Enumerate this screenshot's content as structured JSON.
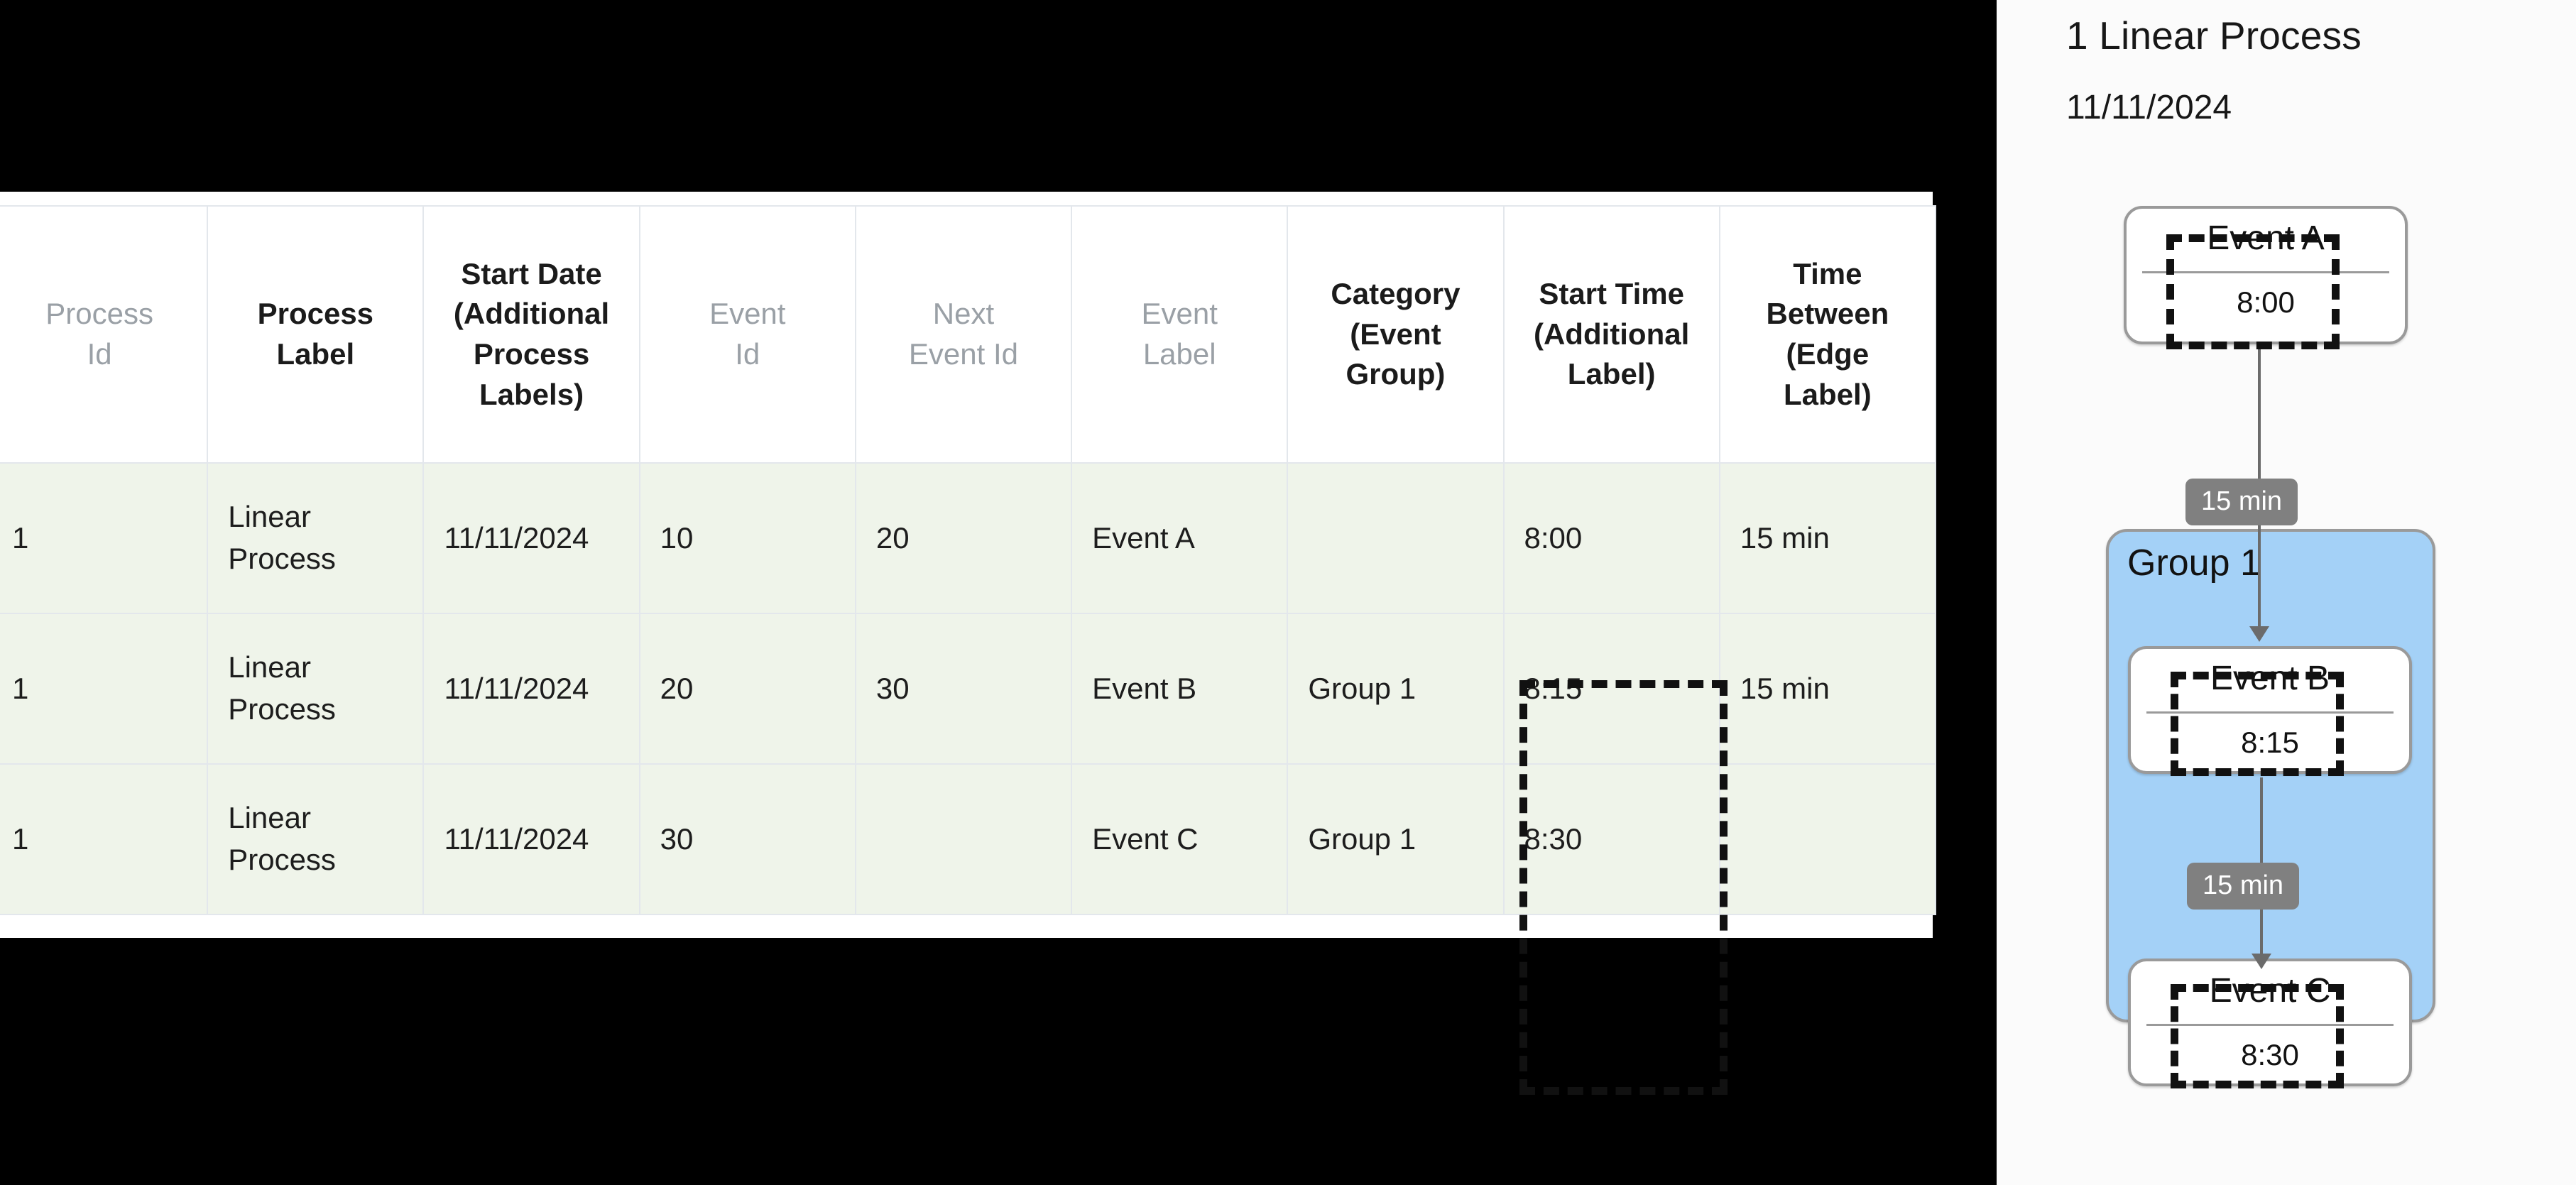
{
  "table": {
    "columns": [
      {
        "label": "Process Id",
        "style": "muted"
      },
      {
        "label": "Process Label",
        "style": "strong"
      },
      {
        "label": "Start Date (Additional Process Labels)",
        "style": "strong"
      },
      {
        "label": "Event Id",
        "style": "muted"
      },
      {
        "label": "Next Event Id",
        "style": "muted"
      },
      {
        "label": "Event Label",
        "style": "muted"
      },
      {
        "label": "Category (Event Group)",
        "style": "strong"
      },
      {
        "label": "Start Time (Additional Label)",
        "style": "strong"
      },
      {
        "label": "Time Between (Edge Label)",
        "style": "strong"
      }
    ],
    "headers": {
      "process_id_l1": "Process",
      "process_id_l2": "Id",
      "process_label_l1": "Process",
      "process_label_l2": "Label",
      "start_date_l1": "Start Date (Additional",
      "start_date_l2": "Process Labels)",
      "event_id_l1": "Event",
      "event_id_l2": "Id",
      "next_event_id_l1": "Next",
      "next_event_id_l2": "Event Id",
      "event_label_l1": "Event",
      "event_label_l2": "Label",
      "category_l1": "Category",
      "category_l2": "(Event",
      "category_l3": "Group)",
      "start_time_l1": "Start Time",
      "start_time_l2": "(Additional",
      "start_time_l3": "Label)",
      "time_between_l1": "Time",
      "time_between_l2": "Between",
      "time_between_l3": "(Edge",
      "time_between_l4": "Label)"
    },
    "rows": [
      {
        "process_id": "1",
        "process_label": "Linear Process",
        "start_date": "11/11/2024",
        "event_id": "10",
        "next_event_id": "20",
        "event_label": "Event A",
        "category": "",
        "start_time": "8:00",
        "time_between": "15 min"
      },
      {
        "process_id": "1",
        "process_label": "Linear Process",
        "start_date": "11/11/2024",
        "event_id": "20",
        "next_event_id": "30",
        "event_label": "Event B",
        "category": "Group 1",
        "start_time": "8:15",
        "time_between": "15 min"
      },
      {
        "process_id": "1",
        "process_label": "Linear Process",
        "start_date": "11/11/2024",
        "event_id": "30",
        "next_event_id": "",
        "event_label": "Event C",
        "category": "Group 1",
        "start_time": "8:30",
        "time_between": ""
      }
    ],
    "highlight": {
      "column": "Start Time (Additional Label)",
      "style": "dashed-black-box"
    }
  },
  "diagram": {
    "title": "1 Linear Process",
    "subtitle": "11/11/2024",
    "group": {
      "label": "Group 1",
      "color": "#a4d1f7"
    },
    "nodes": [
      {
        "title": "Event A",
        "sub": "8:00",
        "highlighted": true
      },
      {
        "title": "Event B",
        "sub": "8:15",
        "highlighted": true
      },
      {
        "title": "Event C",
        "sub": "8:30",
        "highlighted": true
      }
    ],
    "edges": [
      {
        "label": "15 min",
        "from": "Event A",
        "to": "Event B"
      },
      {
        "label": "15 min",
        "from": "Event B",
        "to": "Event C"
      }
    ],
    "colors": {
      "edge_label_bg": "#808080",
      "edge_label_fg": "#ffffff",
      "node_border": "#9a9a9a",
      "group_fill": "#a4d1f7",
      "highlight_dash": "#111111"
    }
  }
}
